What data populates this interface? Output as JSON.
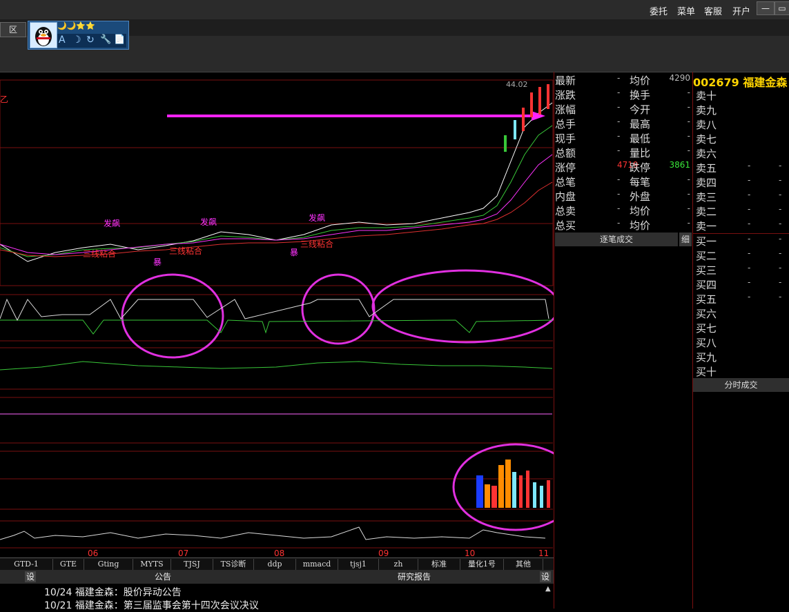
{
  "topbar": {
    "entrust": "委托",
    "menu": "菜单",
    "service": "客服",
    "open_account": "开户"
  },
  "window": {
    "minimize": "—",
    "restore": "▭"
  },
  "region_button": "区",
  "qq": {
    "stars": "🌙🌙⭐⭐",
    "tool_icons": [
      "A",
      "☽",
      "↻",
      "🔧",
      "📄"
    ]
  },
  "stock": {
    "code": "002679",
    "name": "福建金森",
    "price_label": "44.02"
  },
  "quote": {
    "rows": [
      {
        "l1": "最新",
        "v1": "-",
        "l2": "均价",
        "v2": "4290"
      },
      {
        "l1": "涨跌",
        "v1": "-",
        "l2": "换手",
        "v2": "-"
      },
      {
        "l1": "涨幅",
        "v1": "-",
        "l2": "今开",
        "v2": "-"
      },
      {
        "l1": "总手",
        "v1": "-",
        "l2": "最高",
        "v2": "-"
      },
      {
        "l1": "现手",
        "v1": "-",
        "l2": "最低",
        "v2": "-"
      },
      {
        "l1": "总额",
        "v1": "-",
        "l2": "量比",
        "v2": "-"
      },
      {
        "l1": "涨停",
        "v1": "4719",
        "l2": "跌停",
        "v2": "3861"
      },
      {
        "l1": "总笔",
        "v1": "-",
        "l2": "每笔",
        "v2": "-"
      },
      {
        "l1": "内盘",
        "v1": "-",
        "l2": "外盘",
        "v2": "-"
      },
      {
        "l1": "总卖",
        "v1": "-",
        "l2": "均价",
        "v2": "-"
      },
      {
        "l1": "总买",
        "v1": "-",
        "l2": "均价",
        "v2": "-"
      }
    ],
    "tick_header": "逐笔成交",
    "tick_detail": "细"
  },
  "orderbook": {
    "sell": [
      {
        "label": "卖十",
        "p": "",
        "v": ""
      },
      {
        "label": "卖九",
        "p": "",
        "v": ""
      },
      {
        "label": "卖八",
        "p": "",
        "v": ""
      },
      {
        "label": "卖七",
        "p": "",
        "v": ""
      },
      {
        "label": "卖六",
        "p": "",
        "v": ""
      },
      {
        "label": "卖五",
        "p": "-",
        "v": "-"
      },
      {
        "label": "卖四",
        "p": "-",
        "v": "-"
      },
      {
        "label": "卖三",
        "p": "-",
        "v": "-"
      },
      {
        "label": "卖二",
        "p": "-",
        "v": "-"
      },
      {
        "label": "卖一",
        "p": "-",
        "v": "-"
      }
    ],
    "buy": [
      {
        "label": "买一",
        "p": "-",
        "v": "-"
      },
      {
        "label": "买二",
        "p": "-",
        "v": "-"
      },
      {
        "label": "买三",
        "p": "-",
        "v": "-"
      },
      {
        "label": "买四",
        "p": "-",
        "v": "-"
      },
      {
        "label": "买五",
        "p": "-",
        "v": "-"
      },
      {
        "label": "买六",
        "p": "",
        "v": ""
      },
      {
        "label": "买七",
        "p": "",
        "v": ""
      },
      {
        "label": "买八",
        "p": "",
        "v": ""
      },
      {
        "label": "买九",
        "p": "",
        "v": ""
      },
      {
        "label": "买十",
        "p": "",
        "v": ""
      }
    ],
    "time_trades_header": "分时成交"
  },
  "chart_labels": {
    "fa_biao": "发飙",
    "san_xian": "三线粘合",
    "bao": "暴",
    "yi": "乙",
    "month_labels": [
      "06",
      "07",
      "08",
      "09",
      "10",
      "11"
    ],
    "cycle_labels": [
      "GTD-1",
      "GTE",
      "Gting",
      "MYTS",
      "TJSJ",
      "TS诊断",
      "ddp",
      "mmacd",
      "tjsj1",
      "zh",
      "标准",
      "量化1号",
      "其他"
    ]
  },
  "chart_data": {
    "type": "line",
    "title": "",
    "x_months": [
      "06",
      "07",
      "08",
      "09",
      "10",
      "11"
    ],
    "last_price": 44.02,
    "limit_up": 47.19,
    "limit_down": 38.61,
    "note_values": []
  },
  "bottom": {
    "set_label": "设",
    "notice_tab": "公告",
    "research_tab": "研究报告",
    "set_label_right": "设",
    "news": [
      {
        "date": "10/24",
        "text": "福建金森：股价异动公告"
      },
      {
        "date": "10/21",
        "text": "福建金森：第三届监事会第十四次会议决议"
      }
    ]
  }
}
